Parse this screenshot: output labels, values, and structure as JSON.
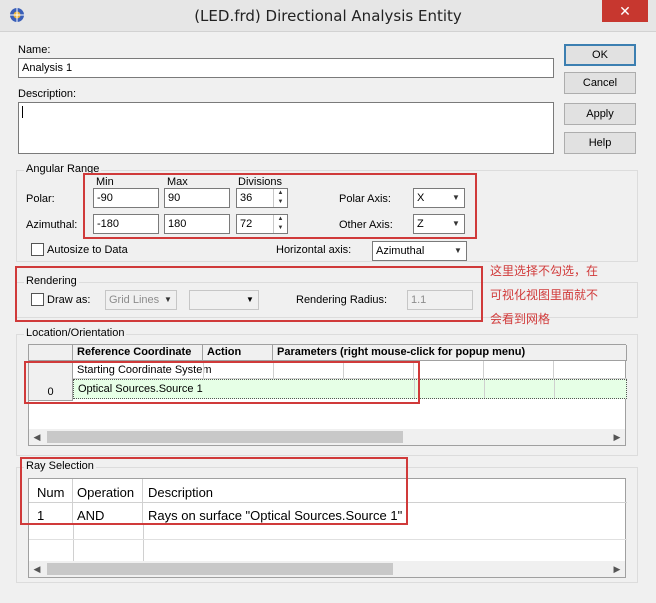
{
  "window": {
    "title": "(LED.frd) Directional Analysis Entity",
    "close_glyph": "✕"
  },
  "name": {
    "label": "Name:",
    "value": "Analysis 1"
  },
  "description": {
    "label": "Description:",
    "value": ""
  },
  "buttons": {
    "ok": "OK",
    "cancel": "Cancel",
    "apply": "Apply",
    "help": "Help"
  },
  "angular_range": {
    "title": "Angular Range",
    "col_min": "Min",
    "col_max": "Max",
    "col_divisions": "Divisions",
    "polar_label": "Polar:",
    "polar_min": "-90",
    "polar_max": "90",
    "polar_divisions": "36",
    "azimuthal_label": "Azimuthal:",
    "az_min": "-180",
    "az_max": "180",
    "az_divisions": "72",
    "polar_axis_label": "Polar Axis:",
    "polar_axis_value": "X",
    "other_axis_label": "Other Axis:",
    "other_axis_value": "Z",
    "autosize_label": "Autosize to Data",
    "horizontal_axis_label": "Horizontal axis:",
    "horizontal_axis_value": "Azimuthal"
  },
  "rendering": {
    "title": "Rendering",
    "draw_as_label": "Draw as:",
    "draw_as_value": "Grid Lines",
    "style_value": "",
    "radius_label": "Rendering Radius:",
    "radius_value": "1.1"
  },
  "annotation": {
    "line1": "这里选择不勾选，在",
    "line2": "可视化视图里面就不",
    "line3": "会看到网格"
  },
  "location": {
    "title": "Location/Orientation",
    "headers": [
      "Reference Coordinate",
      "Action",
      "Parameters (right mouse-click for popup menu)"
    ],
    "row_index": "0",
    "rows": [
      "Starting Coordinate System",
      "Optical Sources.Source 1"
    ]
  },
  "ray_selection": {
    "title": "Ray Selection",
    "headers": [
      "Num",
      "Operation",
      "Description"
    ],
    "rows": [
      {
        "num": "1",
        "operation": "AND",
        "description": "Rays on surface \"Optical Sources.Source 1\""
      }
    ]
  },
  "colors": {
    "annotation_red": "#d03a3a",
    "highlight_row": "#e6ffe6",
    "close_red": "#c7372f"
  }
}
